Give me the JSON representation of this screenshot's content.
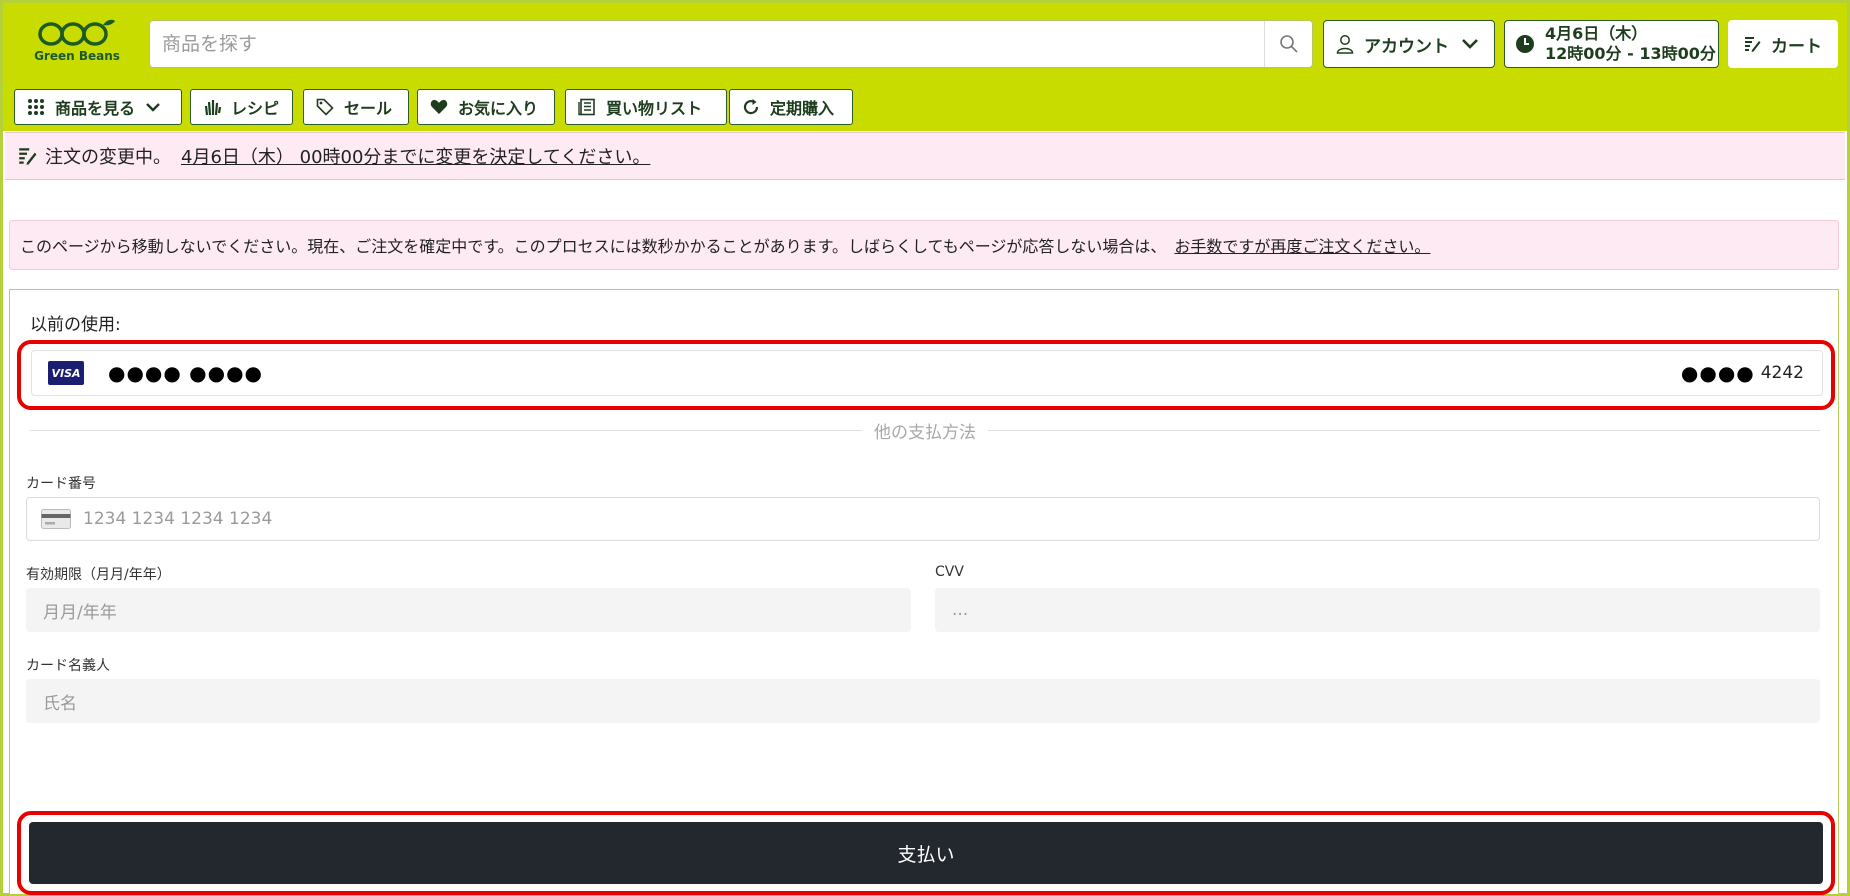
{
  "header": {
    "logo_text": "Green Beans",
    "search_placeholder": "商品を探す",
    "account_label": "アカウント",
    "delivery_date": "4月6日（木）",
    "delivery_time": "12時00分 - 13時00分",
    "cart_label": "カート",
    "brand_color": "#c8dc00"
  },
  "nav": {
    "items": [
      {
        "label": "商品を見る",
        "icon": "grid-icon"
      },
      {
        "label": "レシピ",
        "icon": "hand-icon"
      },
      {
        "label": "セール",
        "icon": "tag-icon"
      },
      {
        "label": "お気に入り",
        "icon": "heart-icon"
      },
      {
        "label": "買い物リスト",
        "icon": "list-icon"
      },
      {
        "label": "定期購入",
        "icon": "refresh-icon"
      }
    ]
  },
  "banner": {
    "message": "注文の変更中。",
    "link": "4月6日（木） 00時00分までに変更を決定してください。"
  },
  "notice": {
    "message": "このページから移動しないでください。現在、ご注文を確定中です。このプロセスには数秒かかることがあります。しばらくしてもページが応答しない場合は、",
    "link": "お手数ですが再度ご注文ください。"
  },
  "payment": {
    "previous_label": "以前の使用:",
    "saved_card": {
      "brand": "VISA",
      "masked": "●●●● ●●●●",
      "last4_dots": "●●●●",
      "last4": "4242"
    },
    "other_methods": "他の支払方法",
    "card_number_label": "カード番号",
    "card_number_placeholder": "1234 1234 1234 1234",
    "expiry_label": "有効期限（月月/年年）",
    "expiry_placeholder": "月月/年年",
    "cvv_label": "CVV",
    "cvv_placeholder": "...",
    "name_label": "カード名義人",
    "name_placeholder": "氏名",
    "pay_button": "支払い"
  },
  "colors": {
    "highlight": "#e80000",
    "pay_button": "#23272e",
    "notice_bg": "#fdeaf2"
  }
}
